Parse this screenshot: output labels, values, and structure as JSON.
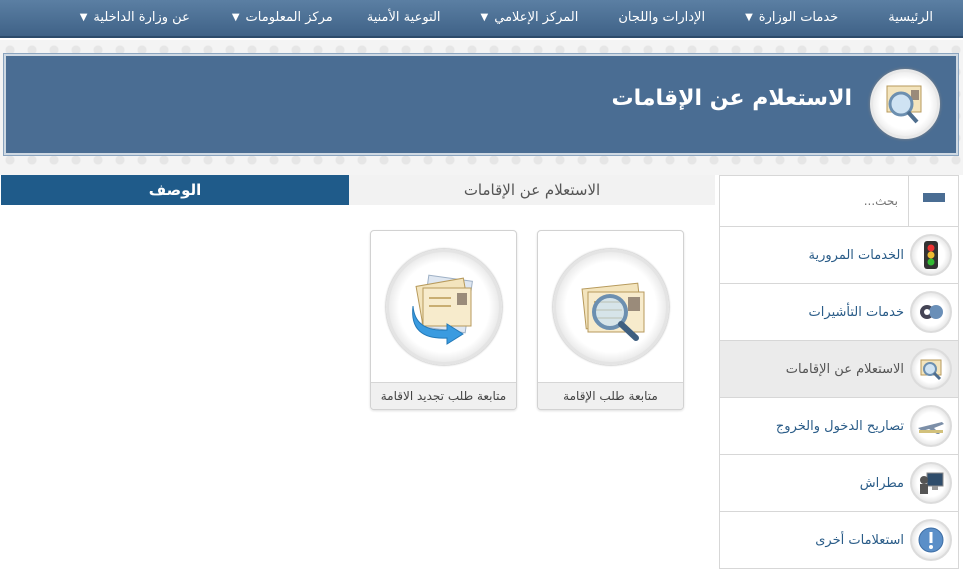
{
  "nav": {
    "items": [
      {
        "label": "الرئيسية",
        "dropdown": false
      },
      {
        "label": "خدمات الوزارة",
        "dropdown": true
      },
      {
        "label": "الإدارات واللجان",
        "dropdown": false
      },
      {
        "label": "المركز الإعلامي",
        "dropdown": true
      },
      {
        "label": "التوعية الأمنية",
        "dropdown": false
      },
      {
        "label": "مركز المعلومات",
        "dropdown": true
      },
      {
        "label": "عن وزارة الداخلية",
        "dropdown": true
      }
    ]
  },
  "banner": {
    "title": "الاستعلام عن الإقامات",
    "icon": "residency-search-icon"
  },
  "sidebar": {
    "search_placeholder": "بحث...",
    "items": [
      {
        "label": "الخدمات المرورية",
        "icon": "traffic-light-icon",
        "active": false
      },
      {
        "label": "خدمات التأشيرات",
        "icon": "visa-icon",
        "active": false
      },
      {
        "label": "الاستعلام عن الإقامات",
        "icon": "residency-search-icon",
        "active": true
      },
      {
        "label": "تصاريح الدخول والخروج",
        "icon": "airplane-icon",
        "active": false
      },
      {
        "label": "مطراش",
        "icon": "computer-user-icon",
        "active": false
      },
      {
        "label": "استعلامات أخرى",
        "icon": "exclamation-icon",
        "active": false
      }
    ]
  },
  "tabs": {
    "main": "الاستعلام عن الإقامات",
    "description": "الوصف"
  },
  "cards": [
    {
      "label": "متابعة طلب الإقامة",
      "icon": "document-magnifier-icon"
    },
    {
      "label": "متابعة طلب تجديد الاقامة",
      "icon": "document-arrow-icon"
    }
  ],
  "colors": {
    "nav": "#4a6d93",
    "accent": "#1f5b8a",
    "link": "#2a5c88"
  }
}
